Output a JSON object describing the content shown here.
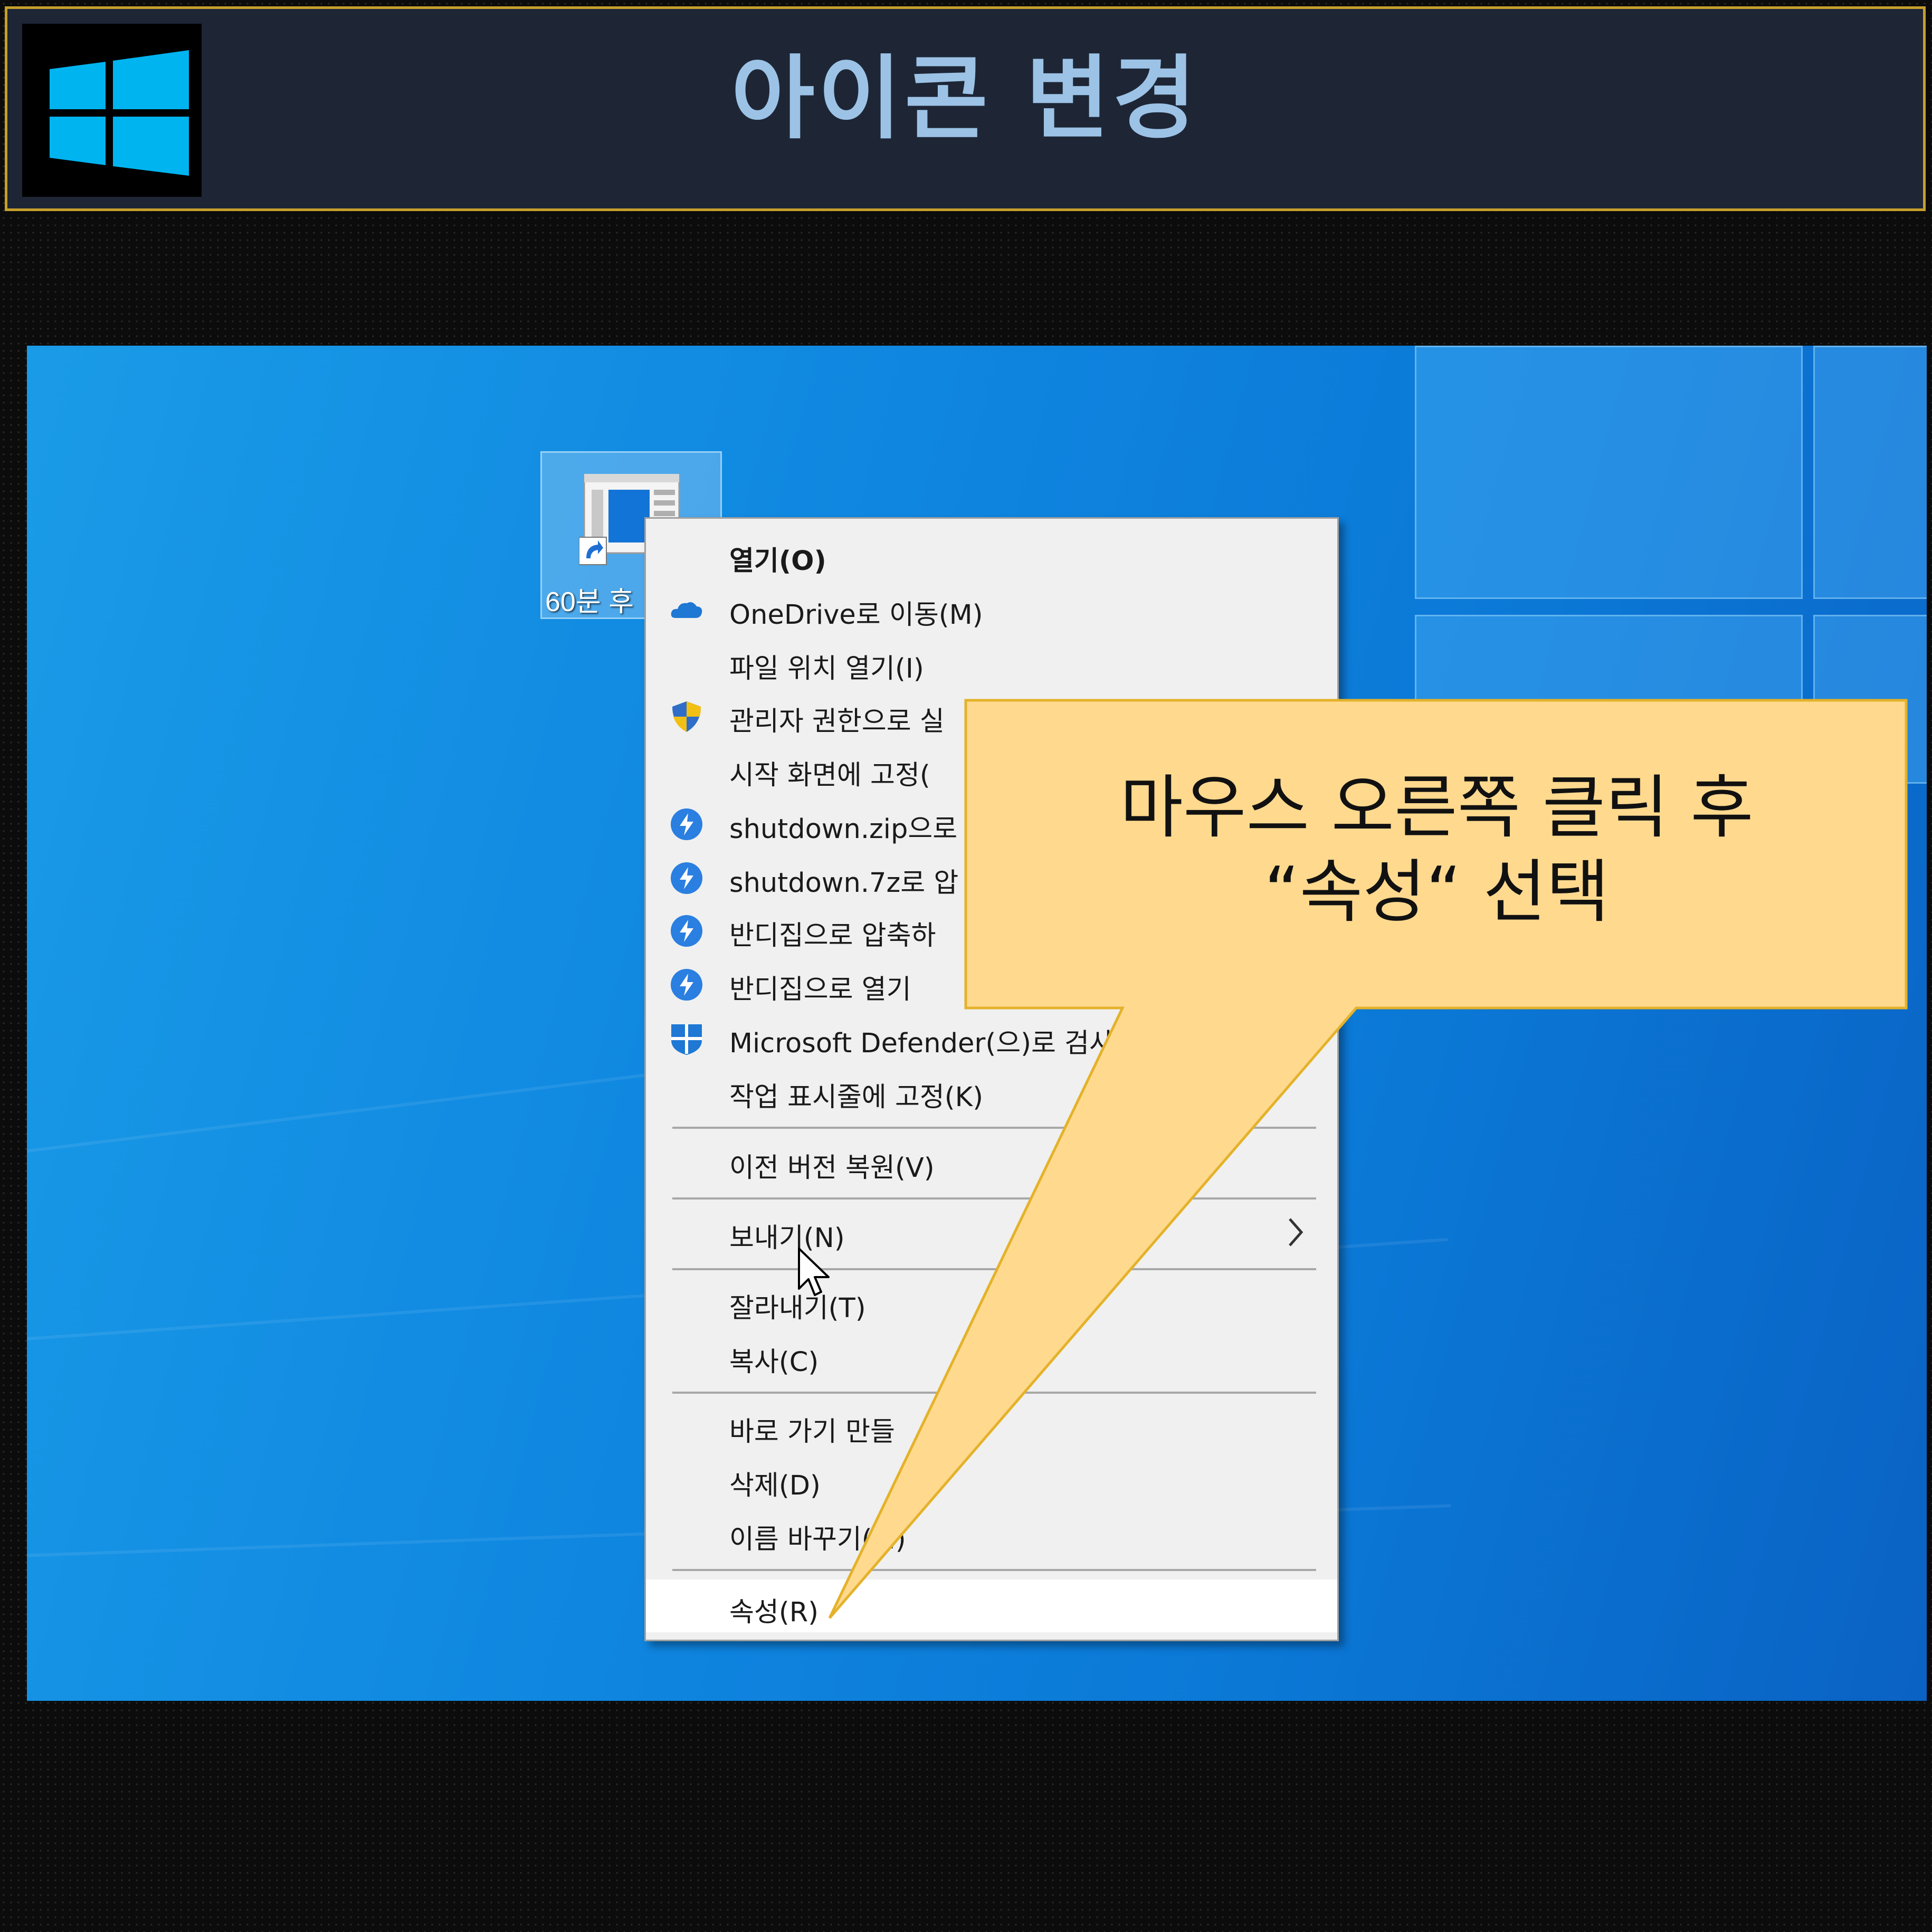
{
  "banner": {
    "title": "아이콘 변경",
    "logo_icon": "windows-logo-icon",
    "border_color": "#c7a02b",
    "title_color": "#9cc3e6"
  },
  "desktop": {
    "icon_label": "60분 후",
    "icon": "shortcut-icon"
  },
  "context_menu": {
    "items": [
      {
        "label": "열기(O)",
        "icon": null,
        "bold": true
      },
      {
        "label": "OneDrive로 이동(M)",
        "icon": "onedrive-cloud-icon"
      },
      {
        "label": "파일 위치 열기(I)",
        "icon": null
      },
      {
        "label": "관리자 권한으로 실",
        "icon": "uac-shield-icon"
      },
      {
        "label": "시작 화면에 고정(",
        "icon": null
      },
      {
        "label": "shutdown.zip으로",
        "icon": "bandizip-icon"
      },
      {
        "label": "shutdown.7z로 압",
        "icon": "bandizip-icon"
      },
      {
        "label": "반디집으로 압축하",
        "icon": "bandizip-icon"
      },
      {
        "label": "반디집으로 열기",
        "icon": "bandizip-icon"
      },
      {
        "label": "Microsoft Defender(으)로 검사",
        "icon": "defender-shield-icon"
      },
      {
        "label": "작업 표시줄에 고정(K)",
        "icon": null
      },
      {
        "label": "이전 버전 복원(V)",
        "icon": null
      },
      {
        "label": "보내기(N)",
        "icon": null,
        "submenu": true
      },
      {
        "label": "잘라내기(T)",
        "icon": null
      },
      {
        "label": "복사(C)",
        "icon": null
      },
      {
        "label": "바로 가기 만들",
        "icon": null
      },
      {
        "label": "삭제(D)",
        "icon": null
      },
      {
        "label": "이름 바꾸기(M)",
        "icon": null
      },
      {
        "label": "속성(R)",
        "icon": null,
        "highlighted": true
      }
    ]
  },
  "callout": {
    "line1": "마우스 오른쪽 클릭 후",
    "line2": "“속성“ 선택",
    "fill": "#ffd98e",
    "stroke": "#e4b22a"
  }
}
